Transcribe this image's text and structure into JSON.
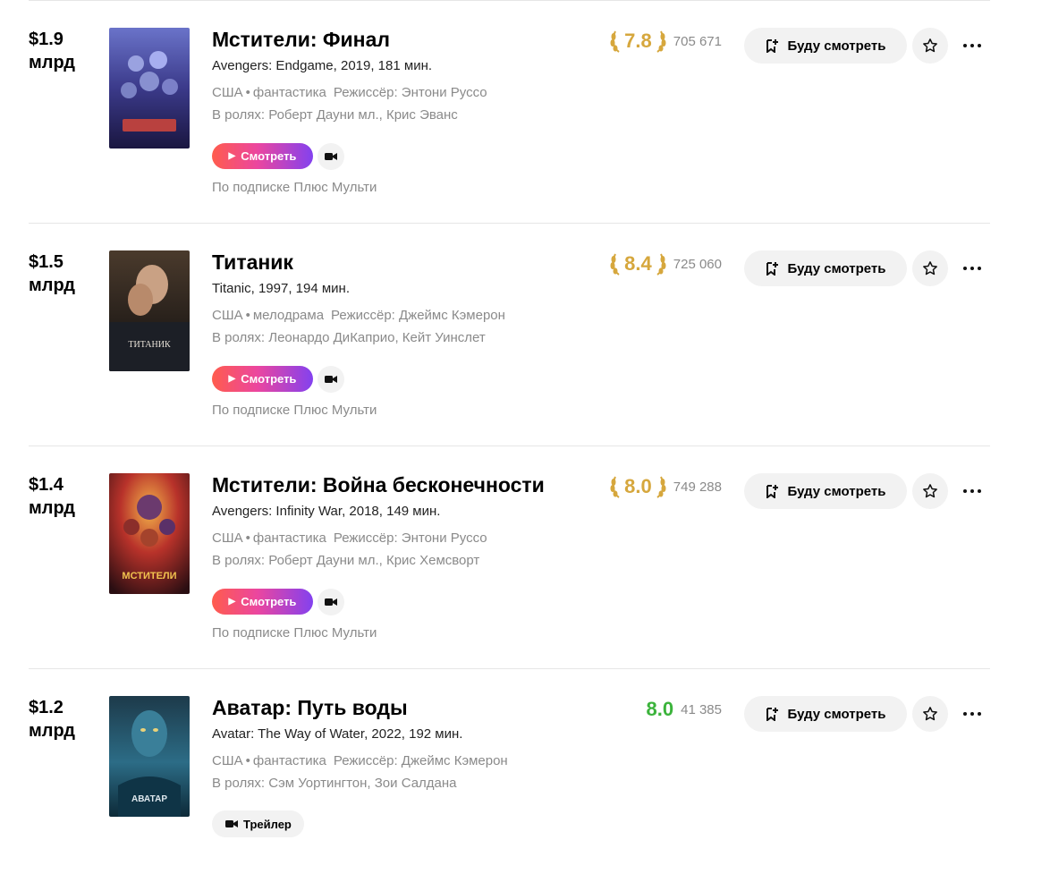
{
  "colors": {
    "accent_gold": "#d6a73d",
    "accent_green": "#3bb33b",
    "muted": "#8a8a8a"
  },
  "actions": {
    "watch_label": "Смотреть",
    "trailer_label": "Трейлер",
    "want_label": "Буду смотреть"
  },
  "films": [
    {
      "box_amount": "$1.9",
      "box_unit": "млрд",
      "title": "Мстители: Финал",
      "original": "Avengers: Endgame, 2019, 181 мин.",
      "country": "США",
      "genre": "фантастика",
      "director": "Режиссёр: Энтони Руссо",
      "cast": "В ролях: Роберт Дауни мл., Крис Эванс",
      "rating": "7.8",
      "rating_style": "gold",
      "votes": "705 671",
      "subscription": "По подписке Плюс Мульти",
      "poster_icon": "avengers-endgame-poster"
    },
    {
      "box_amount": "$1.5",
      "box_unit": "млрд",
      "title": "Титаник",
      "original": "Titanic, 1997, 194 мин.",
      "country": "США",
      "genre": "мелодрама",
      "director": "Режиссёр: Джеймс Кэмерон",
      "cast": "В ролях: Леонардо ДиКаприо, Кейт Уинслет",
      "rating": "8.4",
      "rating_style": "gold",
      "votes": "725 060",
      "subscription": "По подписке Плюс Мульти",
      "poster_icon": "titanic-poster",
      "poster_text": "ТИТАНИК"
    },
    {
      "box_amount": "$1.4",
      "box_unit": "млрд",
      "title": "Мстители: Война бесконечности",
      "original": "Avengers: Infinity War, 2018, 149 мин.",
      "country": "США",
      "genre": "фантастика",
      "director": "Режиссёр: Энтони Руссо",
      "cast": "В ролях: Роберт Дауни мл., Крис Хемсворт",
      "rating": "8.0",
      "rating_style": "gold",
      "votes": "749 288",
      "subscription": "По подписке Плюс Мульти",
      "poster_icon": "avengers-infinity-war-poster",
      "poster_text": "МСТИТЕЛИ"
    },
    {
      "box_amount": "$1.2",
      "box_unit": "млрд",
      "title": "Аватар: Путь воды",
      "original": "Avatar: The Way of Water, 2022, 192 мин.",
      "country": "США",
      "genre": "фантастика",
      "director": "Режиссёр: Джеймс Кэмерон",
      "cast": "В ролях: Сэм Уортингтон, Зои Салдана",
      "rating": "8.0",
      "rating_style": "green",
      "votes": "41 385",
      "poster_icon": "avatar-way-of-water-poster",
      "poster_text": "АВАТАР"
    }
  ]
}
